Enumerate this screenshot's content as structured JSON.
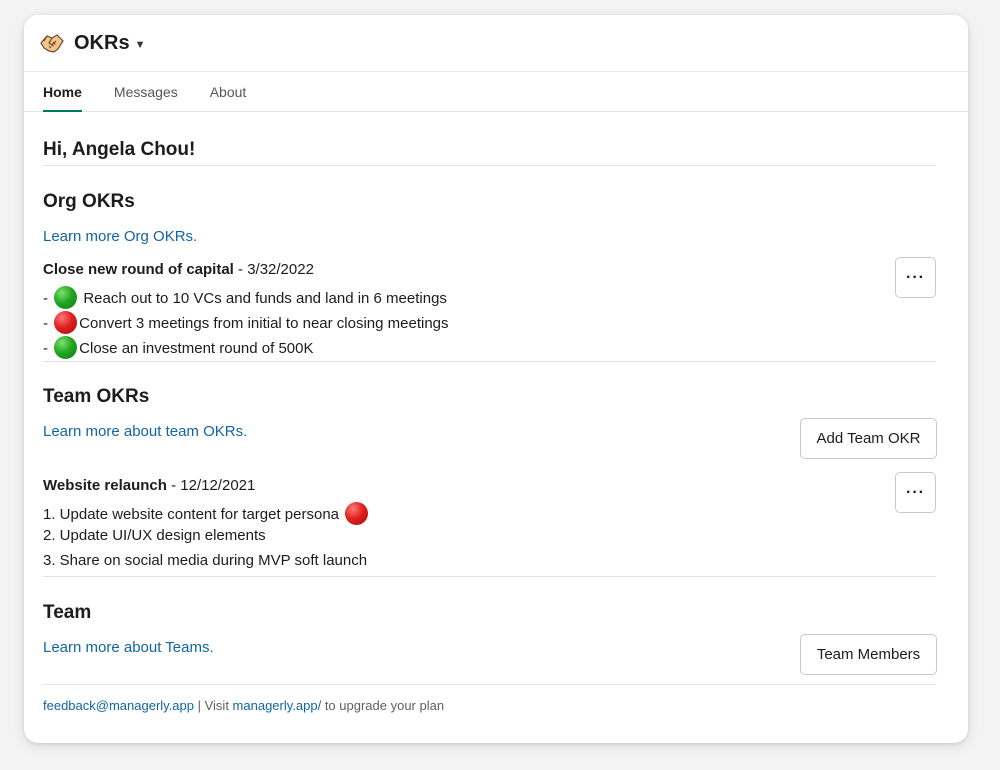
{
  "app": {
    "title": "OKRs"
  },
  "tabs": [
    {
      "label": "Home",
      "active": true
    },
    {
      "label": "Messages",
      "active": false
    },
    {
      "label": "About",
      "active": false
    }
  ],
  "greeting": "Hi, Angela Chou!",
  "org": {
    "heading": "Org OKRs",
    "learn_link": "Learn more Org OKRs.",
    "okr": {
      "title": "Close new round of capital",
      "date": " - 3/32/2022",
      "items": [
        {
          "prefix": "- ",
          "status": "green",
          "text": " Reach out to 10 VCs and funds and land in 6 meetings"
        },
        {
          "prefix": "- ",
          "status": "red",
          "text": "Convert 3 meetings from initial to near closing meetings"
        },
        {
          "prefix": "- ",
          "status": "green",
          "text": "Close an investment round of 500K"
        }
      ],
      "more_label": "···"
    }
  },
  "team_okrs": {
    "heading": "Team OKRs",
    "learn_link": "Learn more about team OKRs.",
    "add_button": "Add Team OKR",
    "okr": {
      "title": "Website relaunch",
      "date": " - 12/12/2021",
      "items": [
        {
          "text": "1. Update website content for target persona",
          "status": "red"
        },
        {
          "text": "2. Update UI/UX design elements"
        },
        {
          "text": "3. Share on social media during MVP soft launch"
        }
      ],
      "more_label": "···"
    }
  },
  "team": {
    "heading": "Team",
    "learn_link": "Learn more about Teams.",
    "members_button": "Team Members"
  },
  "footer": {
    "email": "feedback@managerly.app",
    "sep": " | Visit ",
    "site": "managerly.app/",
    "tail": " to upgrade your plan"
  },
  "colors": {
    "link": "#1264a3",
    "tab_active": "#007a5a",
    "status_green": "#25a624",
    "status_red": "#e0201f"
  }
}
